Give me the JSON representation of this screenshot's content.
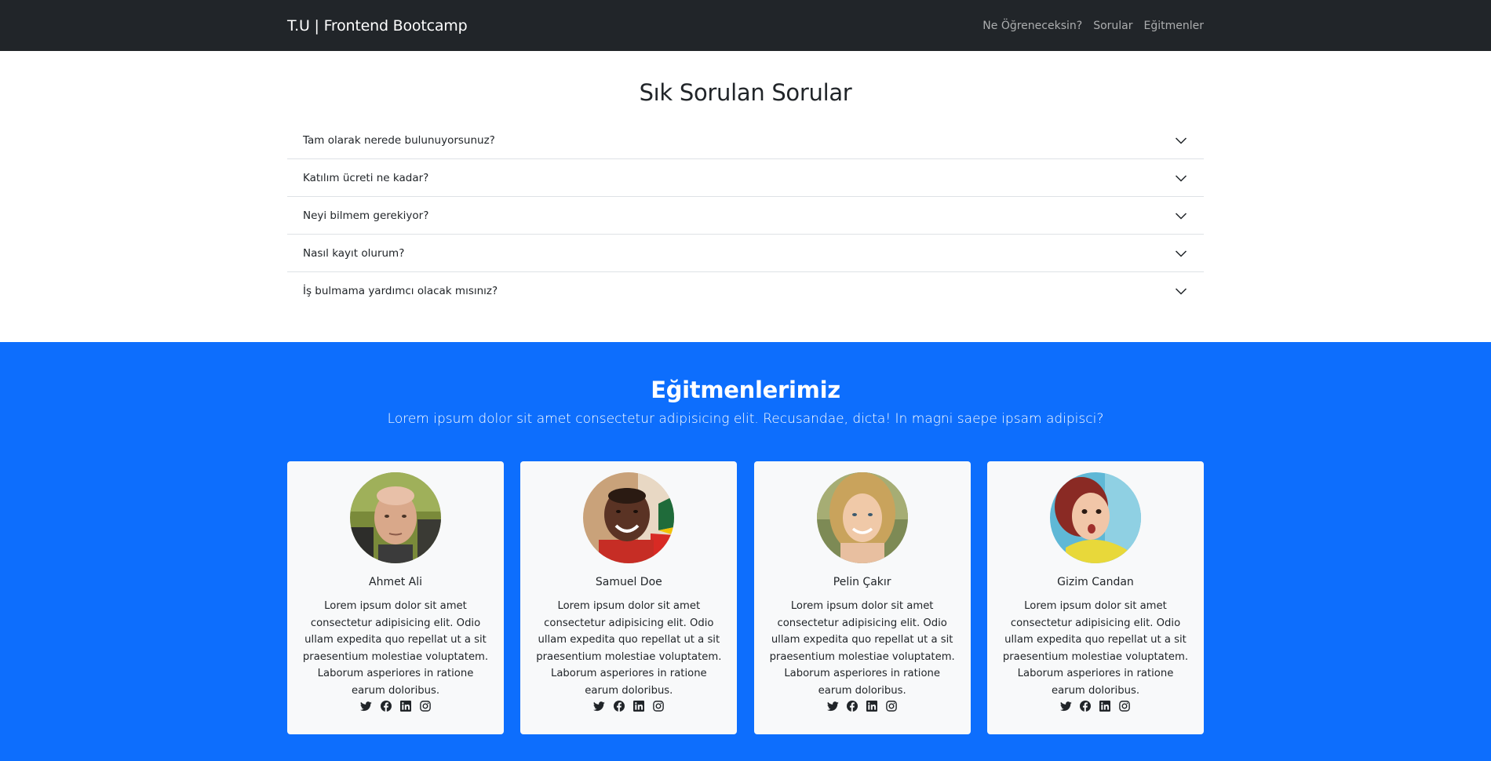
{
  "nav": {
    "brand": "T.U | Frontend Bootcamp",
    "links": [
      "Ne Öğreneceksin?",
      "Sorular",
      "Eğitmenler"
    ]
  },
  "faq": {
    "title": "Sık Sorulan Sorular",
    "items": [
      "Tam olarak nerede bulunuyorsunuz?",
      "Katılım ücreti ne kadar?",
      "Neyi bilmem gerekiyor?",
      "Nasıl kayıt olurum?",
      "İş bulmama yardımcı olacak mısınız?"
    ]
  },
  "instructors": {
    "title": "Eğitmenlerimiz",
    "lead": "Lorem ipsum dolor sit amet consectetur adipisicing elit. Recusandae, dicta! In magni saepe ipsam adipisci?",
    "cards": [
      {
        "name": "Ahmet Ali",
        "text": "Lorem ipsum dolor sit amet consectetur adipisicing elit. Odio ullam expedita quo repellat ut a sit praesentium molestiae voluptatem. Laborum asperiores in ratione earum doloribus."
      },
      {
        "name": "Samuel Doe",
        "text": "Lorem ipsum dolor sit amet consectetur adipisicing elit. Odio ullam expedita quo repellat ut a sit praesentium molestiae voluptatem. Laborum asperiores in ratione earum doloribus."
      },
      {
        "name": "Pelin Çakır",
        "text": "Lorem ipsum dolor sit amet consectetur adipisicing elit. Odio ullam expedita quo repellat ut a sit praesentium molestiae voluptatem. Laborum asperiores in ratione earum doloribus."
      },
      {
        "name": "Gizim Candan",
        "text": "Lorem ipsum dolor sit amet consectetur adipisicing elit. Odio ullam expedita quo repellat ut a sit praesentium molestiae voluptatem. Laborum asperiores in ratione earum doloribus."
      }
    ],
    "social_icons": [
      "twitter-icon",
      "facebook-icon",
      "linkedin-icon",
      "instagram-icon"
    ]
  },
  "colors": {
    "navbar_bg": "#212529",
    "primary": "#0d6efd",
    "card_bg": "#f8f9fa"
  }
}
